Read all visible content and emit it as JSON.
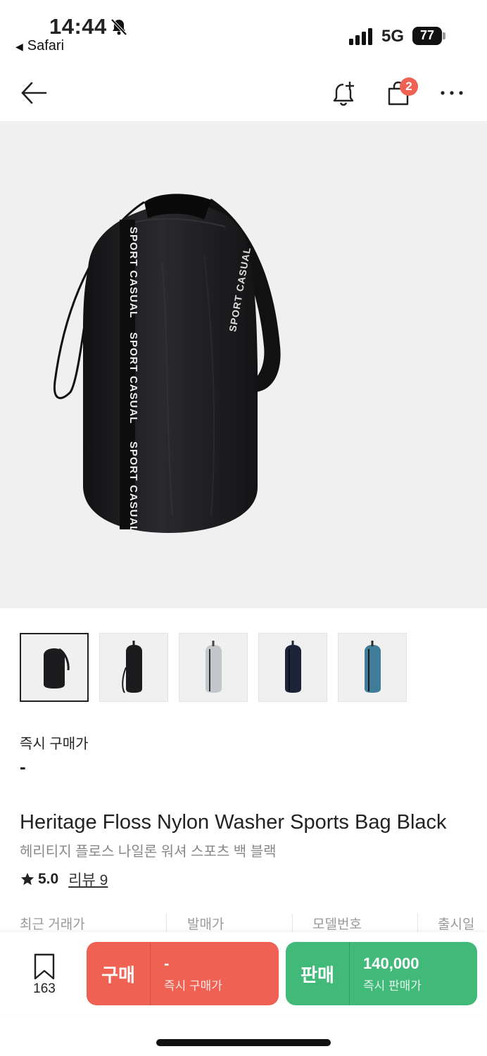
{
  "status_bar": {
    "time": "14:44",
    "back_app": "Safari",
    "network": "5G",
    "battery": "77"
  },
  "nav": {
    "cart_badge": "2"
  },
  "product": {
    "strap_text": "SPORT CASUAL",
    "instant_buy_label": "즉시 구매가",
    "instant_buy_value": "-",
    "title_en": "Heritage Floss Nylon Washer Sports Bag Black",
    "title_ko": "헤리티지 플로스 나일론 워셔 스포츠 백 블랙",
    "rating": "5.0",
    "review_label": "리뷰 9"
  },
  "thumbnails": [
    {
      "color": "#1c1c1e"
    },
    {
      "color": "#1c1c1e"
    },
    {
      "color": "#c3c7cb"
    },
    {
      "color": "#1e2438"
    },
    {
      "color": "#3f7d9a"
    }
  ],
  "info_row": {
    "recent_price": "최근 거래가",
    "release_price": "발매가",
    "model_number": "모델번호",
    "release_date": "출시일"
  },
  "action_bar": {
    "wish_count": "163",
    "buy_label": "구매",
    "buy_price": "-",
    "buy_sub": "즉시 구매가",
    "sell_label": "판매",
    "sell_price": "140,000",
    "sell_sub": "즉시 판매가"
  },
  "colors": {
    "buy": "#ef6253",
    "sell": "#41b979",
    "badge": "#ef6253"
  }
}
